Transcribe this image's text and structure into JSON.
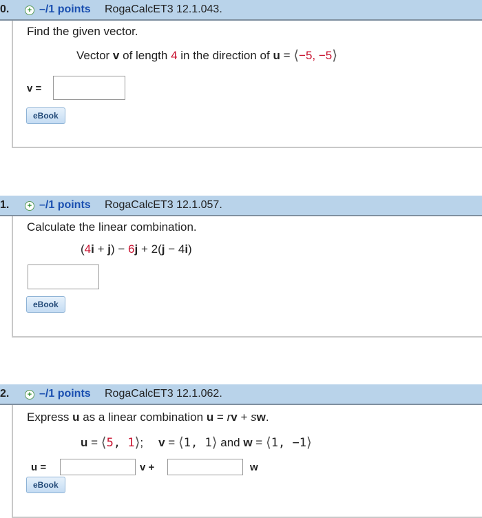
{
  "questions": [
    {
      "number": "0.",
      "points": "–/1 points",
      "problem_id": "RogaCalcET3 12.1.043.",
      "prompt": "Find the given vector.",
      "statement": {
        "pre": "Vector ",
        "v": "v",
        "mid1": " of length ",
        "length": "4",
        "mid2": " in the direction of ",
        "u": "u",
        "eq": " = ",
        "open": "⟨",
        "value": "−5, −5",
        "close": "⟩"
      },
      "answer_label": "v =",
      "ebook_label": "eBook"
    },
    {
      "number": "1.",
      "points": "–/1 points",
      "problem_id": "RogaCalcET3 12.1.057.",
      "prompt": "Calculate the linear combination.",
      "expression": {
        "p1": "(",
        "c1": "4",
        "i1": "i",
        "p2": " + ",
        "j1": "j",
        "p3": ") − ",
        "c2": "6",
        "j2": "j",
        "p4": " + 2(",
        "j3": "j",
        "p5": " − 4",
        "i2": "i",
        "p6": ")"
      },
      "ebook_label": "eBook"
    },
    {
      "number": "2.",
      "points": "–/1 points",
      "problem_id": "RogaCalcET3 12.1.062.",
      "prompt": {
        "pre": "Express ",
        "u": "u",
        "mid": " as a linear combination ",
        "u2": "u",
        "eq": " = ",
        "r": "r",
        "v": "v",
        "plus": " + ",
        "s": "s",
        "w": "w",
        "end": "."
      },
      "given": {
        "u_label": "u",
        "u_eq": " = ",
        "u_open": "⟨",
        "u_a": "5",
        "u_sep": ", ",
        "u_b": "1",
        "u_close": "⟩",
        "semicolon": ";",
        "v_label": "v",
        "v_eq": " = ",
        "v_open": "⟨",
        "v_val": "1, 1",
        "v_close": "⟩",
        "and": " and ",
        "w_label": "w",
        "w_eq": " = ",
        "w_open": "⟨",
        "w_val": "1, −1",
        "w_close": "⟩"
      },
      "answer_labels": {
        "u": "u =",
        "v": "v +",
        "w": "w"
      },
      "ebook_label": "eBook"
    }
  ]
}
